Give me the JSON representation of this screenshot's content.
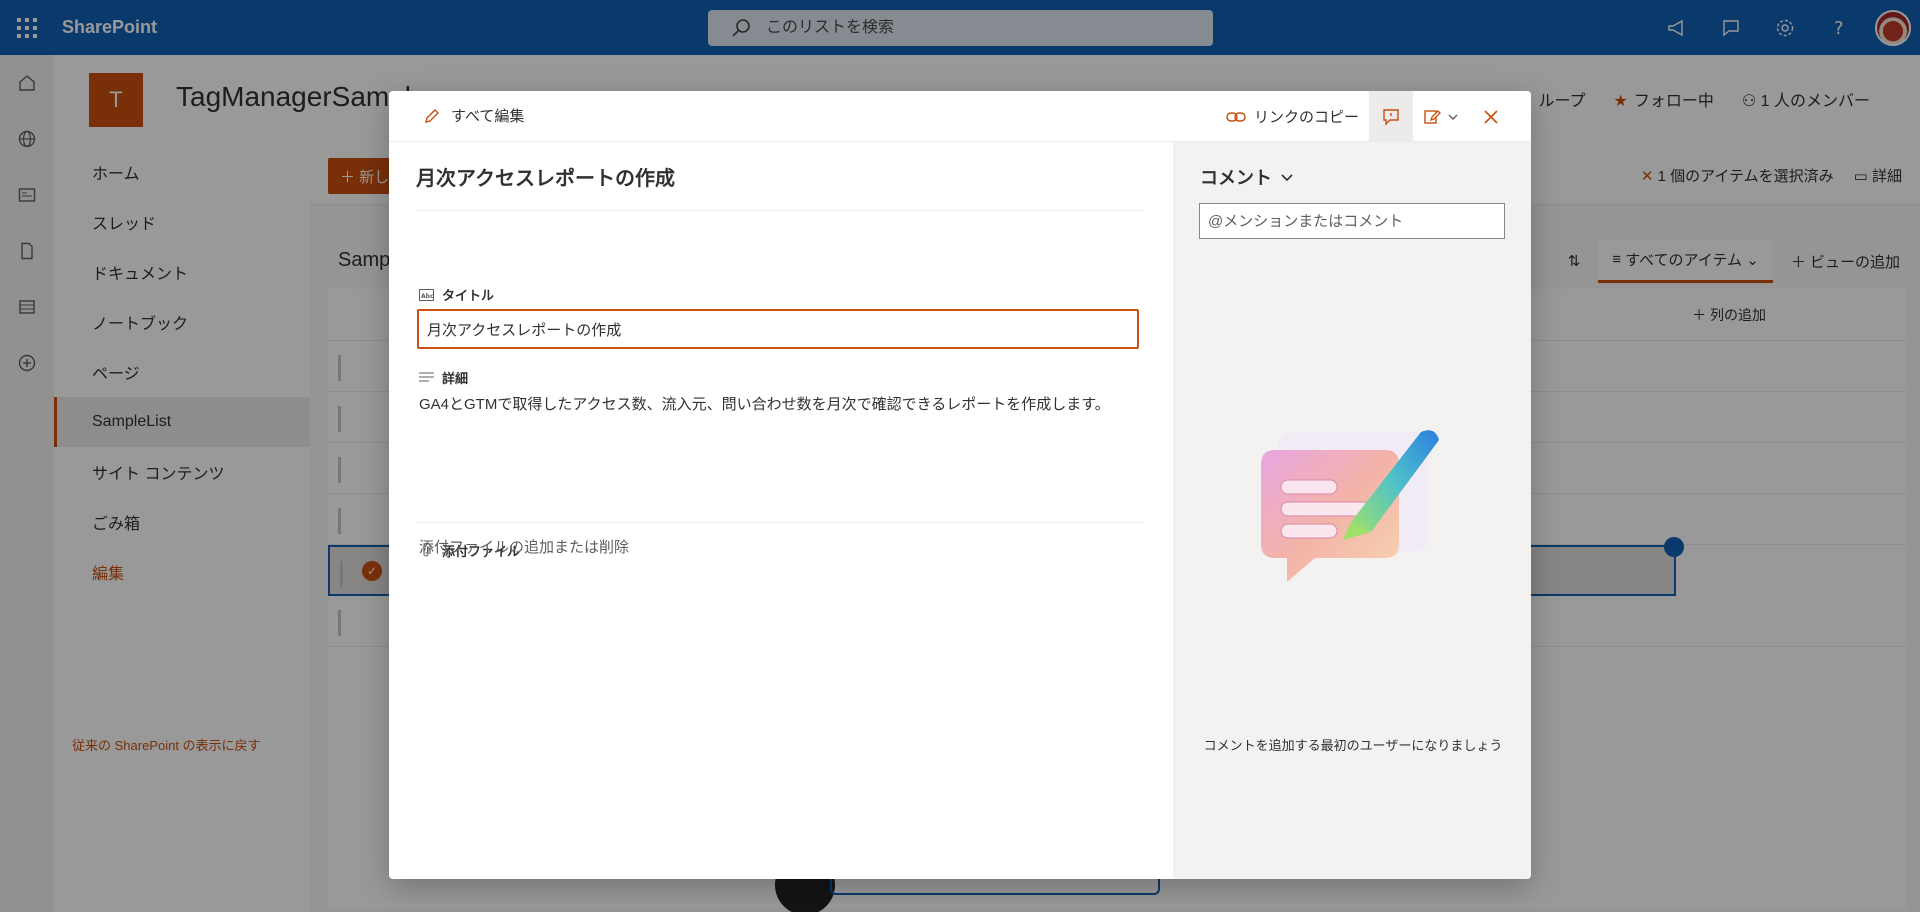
{
  "suitebar": {
    "brand": "SharePoint",
    "search_placeholder": "このリストを検索"
  },
  "site": {
    "logo_letter": "T",
    "title": "TagManagerSampl",
    "actions": {
      "group": "ループ",
      "follow": "フォロー中",
      "members": "1 人のメンバー"
    }
  },
  "nav": {
    "items": [
      {
        "label": "ホーム"
      },
      {
        "label": "スレッド"
      },
      {
        "label": "ドキュメント"
      },
      {
        "label": "ノートブック"
      },
      {
        "label": "ページ"
      },
      {
        "label": "SampleList"
      },
      {
        "label": "サイト コンテンツ"
      },
      {
        "label": "ごみ箱"
      },
      {
        "label": "編集"
      }
    ],
    "back_link": "従来の SharePoint の表示に戻す"
  },
  "main": {
    "new_label": "新し",
    "selected_info": "1 個のアイテムを選択済み",
    "details": "詳細",
    "list_title": "Samp",
    "view_label": "すべてのアイテム",
    "add_view": "ビューの追加",
    "add_column": "列の追加"
  },
  "dialog": {
    "edit_all": "すべて編集",
    "copy_link": "リンクのコピー",
    "item_title": "月次アクセスレポートの作成",
    "fields": {
      "title_label": "タイトル",
      "title_value": "月次アクセスレポートの作成",
      "description_label": "詳細",
      "description_value": "GA4とGTMで取得したアクセス数、流入元、問い合わせ数を月次で確認できるレポートを作成します。",
      "attachments_label": "添付ファイル",
      "attachments_action": "添付ファイルの追加または削除"
    },
    "comments": {
      "header": "コメント",
      "input_placeholder": "@メンションまたはコメント",
      "empty_message": "コメントを追加する最初のユーザーになりましょう"
    }
  },
  "colors": {
    "suitebar": "#1061b3",
    "accent": "#ca5010"
  }
}
